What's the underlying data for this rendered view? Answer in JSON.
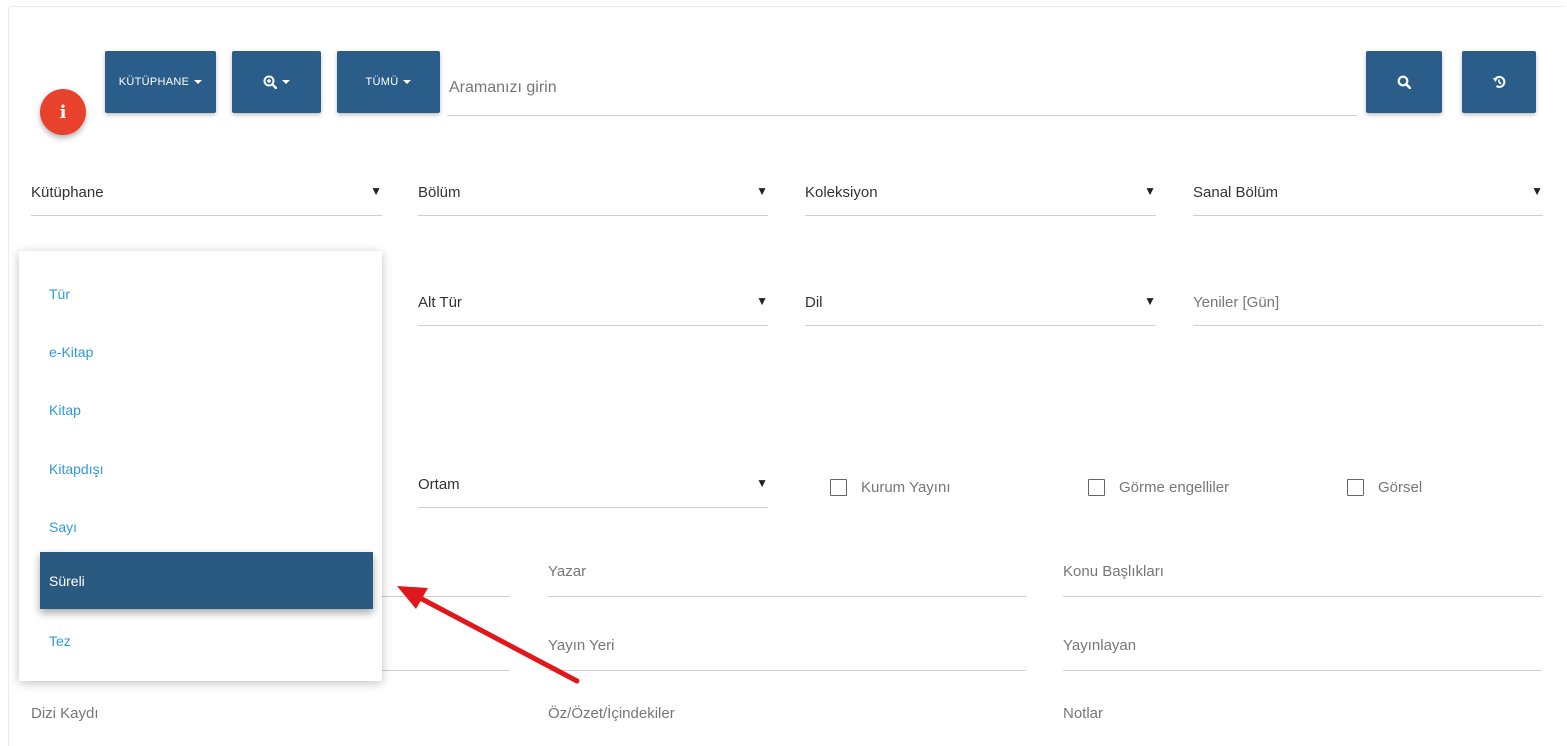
{
  "toolbar": {
    "info_glyph": "i",
    "library_label": "KÜTÜPHANE",
    "scope_label": "TÜMÜ",
    "search_placeholder": "Aramanızı girin"
  },
  "filters": {
    "kutuphane": "Kütüphane",
    "bolum": "Bölüm",
    "koleksiyon": "Koleksiyon",
    "sanal_bolum": "Sanal Bölüm",
    "alt_tur": "Alt Tür",
    "dil": "Dil",
    "yeniler": "Yeniler [Gün]",
    "ortam": "Ortam"
  },
  "checkboxes": {
    "kurum_yayini": "Kurum Yayını",
    "gorme_engelliler": "Görme engelliler",
    "gorsel": "Görsel"
  },
  "text_fields": {
    "yazar": "Yazar",
    "konu_basliklari": "Konu Başlıkları",
    "yayin_yeri": "Yayın Yeri",
    "yayinlayan": "Yayınlayan",
    "dizi_kaydi": "Dizi Kaydı",
    "oz_ozet": "Öz/Özet/İçindekiler",
    "notlar": "Notlar"
  },
  "type_dropdown": {
    "items": [
      "Tür",
      "e-Kitap",
      "Kitap",
      "Kitapdışı",
      "Sayı",
      "Süreli",
      "Tez"
    ],
    "selected": "Süreli"
  },
  "colors": {
    "primary_button": "#2b5d8a",
    "info_button": "#e8412c",
    "dropdown_link": "#2f9bd6",
    "selected_item": "#2b5a80",
    "annotation_arrow": "#e0181b"
  },
  "icons": {
    "info": "info-icon",
    "zoom_filter": "zoom-plus-icon",
    "search": "search-icon",
    "reset": "reset-icon"
  }
}
